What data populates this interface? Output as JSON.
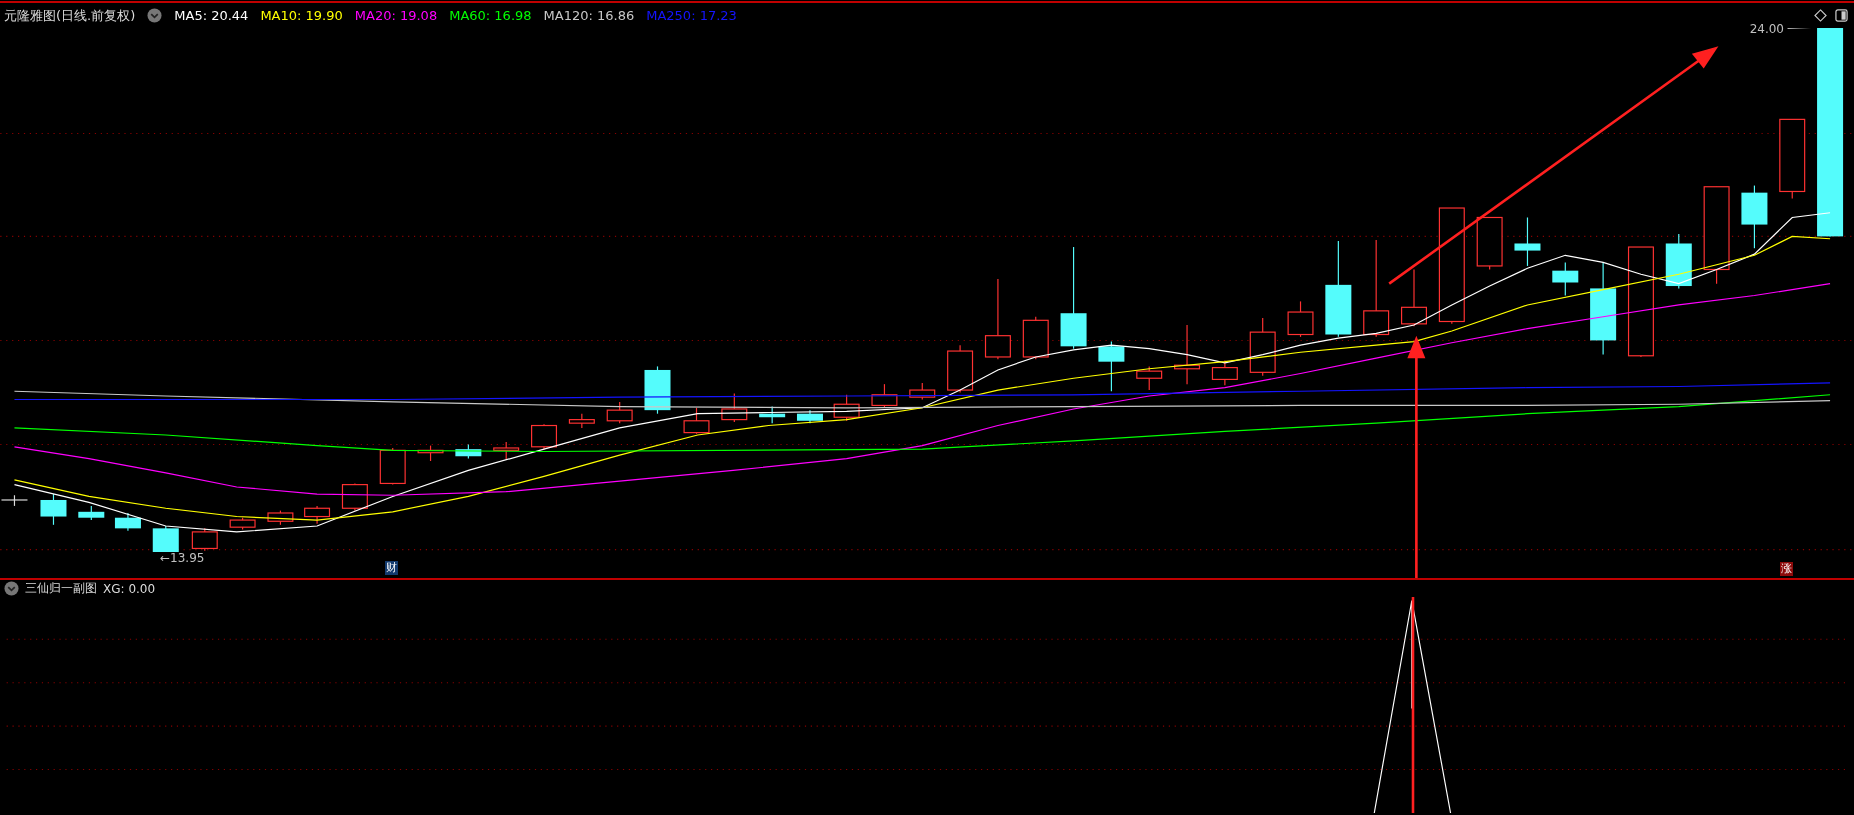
{
  "header": {
    "title": "元隆雅图(日线.前复权)",
    "indicators": [
      {
        "label": "MA5: 20.44",
        "color": "#ffffff"
      },
      {
        "label": "MA10: 19.90",
        "color": "#ffff00"
      },
      {
        "label": "MA20: 19.08",
        "color": "#ff00ff"
      },
      {
        "label": "MA60: 16.98",
        "color": "#00ff00"
      },
      {
        "label": "MA120: 16.86",
        "color": "#c8c8c8"
      },
      {
        "label": "MA250: 17.23",
        "color": "#1414ff"
      }
    ]
  },
  "price_labels": [
    {
      "kind": "high",
      "text": "24.00"
    },
    {
      "kind": "low",
      "text": "←13.95"
    }
  ],
  "event_markers": [
    {
      "text": "财",
      "color": "#123a6e"
    },
    {
      "text": "涨",
      "color": "#8c0a0a"
    }
  ],
  "sub_chart": {
    "title": "三仙归一副图",
    "reading": "XG: 0.00"
  }
}
